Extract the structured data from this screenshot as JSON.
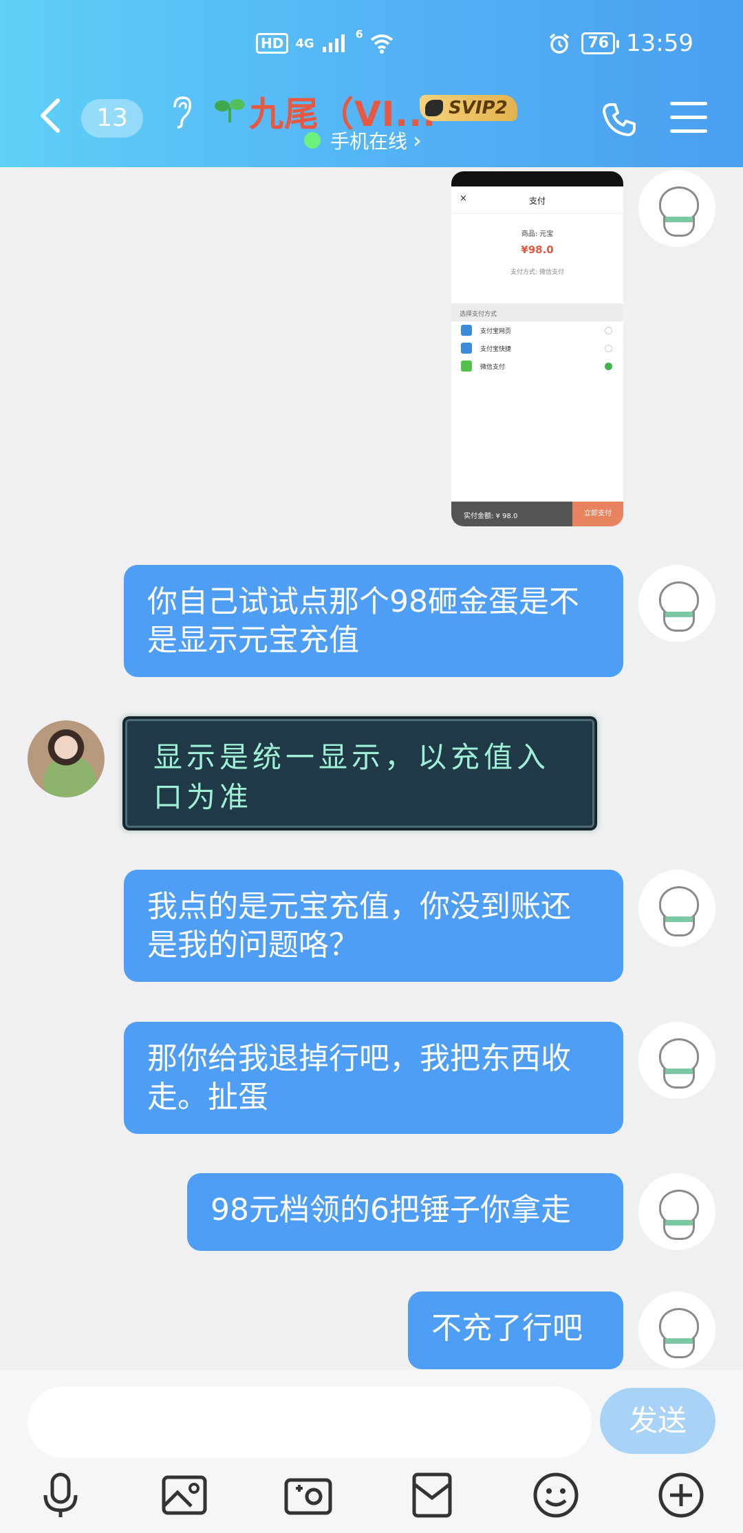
{
  "status_bar": {
    "hd": "HD",
    "network": "4G",
    "wifi_sub": "6",
    "battery": "76",
    "time": "13:59"
  },
  "header": {
    "back_count": "13",
    "contact_name": "九尾（VI...",
    "vip_badge": "SVIP2",
    "online_status": "手机在线",
    "online_arrow": "›"
  },
  "screenshot_message": {
    "close": "×",
    "title": "支付",
    "goods": "商品: 元宝",
    "price": "¥98.0",
    "pay_way": "支付方式: 微信支付",
    "section_label": "选择支付方式",
    "options": [
      {
        "label": "支付宝网页",
        "selected": false,
        "color": "#3c8bd9"
      },
      {
        "label": "支付宝快捷",
        "selected": false,
        "color": "#3c8bd9"
      },
      {
        "label": "微信支付",
        "selected": true,
        "color": "#55c14a"
      }
    ],
    "amount": "实付金额: ¥ 98.0",
    "pay_button": "立即支付"
  },
  "messages": [
    {
      "side": "right",
      "text": "你自己试试点那个98砸金蛋是不是显示元宝充值"
    },
    {
      "side": "left",
      "text": "显示是统一显示，以充值入口为准"
    },
    {
      "side": "right",
      "text": "我点的是元宝充值，你没到账还是我的问题咯？"
    },
    {
      "side": "right",
      "text": "那你给我退掉行吧，我把东西收走。扯蛋"
    },
    {
      "side": "right",
      "text": "98元档领的6把锤子你拿走"
    },
    {
      "side": "right",
      "text": "不充了行吧"
    }
  ],
  "input": {
    "placeholder": "",
    "send_label": "发送"
  },
  "toolbar": [
    "microphone-icon",
    "image-icon",
    "camera-icon",
    "red-packet-icon",
    "emoji-icon",
    "plus-icon"
  ],
  "colors": {
    "bubble_self": "#4e9ef6",
    "header_gradient_start": "#5fd0f7",
    "header_gradient_end": "#4a9ff0",
    "name_color": "#e8573f"
  }
}
